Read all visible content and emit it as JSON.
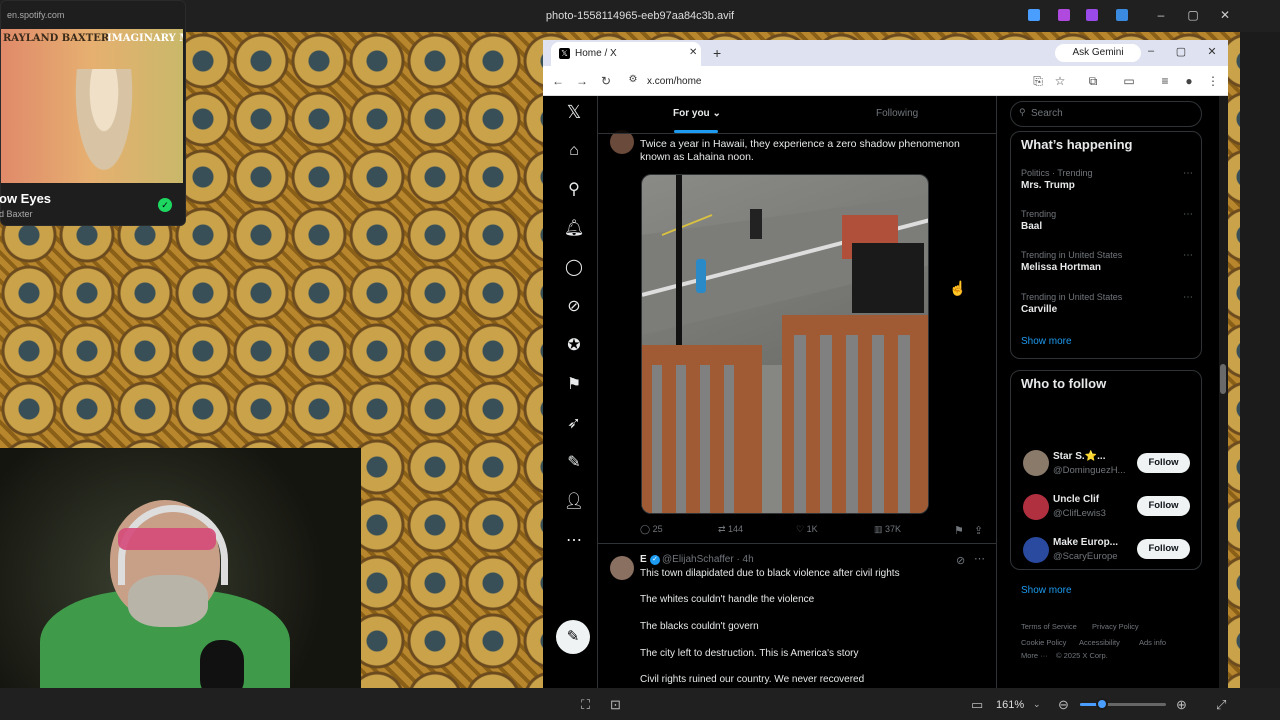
{
  "viewer": {
    "title": "photo-1558114965-eeb97aa84c3b.avif",
    "zoom": "161%",
    "zoom_fraction": 0.23
  },
  "spotify": {
    "url": "en.spotify.com",
    "art_text_artist": "RAYLAND BAXTER",
    "art_text_album": "IMAGINARY MAN",
    "track": "ow Eyes",
    "artist": "d Baxter"
  },
  "browser": {
    "tab_title": "Home / X",
    "ask_gemini": "Ask Gemini",
    "url": "x.com/home"
  },
  "x": {
    "tabs": {
      "for_you": "For you",
      "following": "Following"
    },
    "post1": {
      "text": "Twice a year in Hawaii, they experience a zero shadow phenomenon known as Lahaina noon.",
      "replies": "25",
      "reposts": "144",
      "likes": "1K",
      "views": "37K"
    },
    "post2": {
      "name": "E",
      "handle": "@ElijahSchaffer · 4h",
      "lines": [
        "This town dilapidated due to black violence after civil rights",
        "The whites couldn't handle the violence",
        "The blacks couldn't govern",
        "The city left to destruction. This is America's story",
        "Civil rights ruined our country. We never recovered"
      ]
    },
    "search_placeholder": "Search",
    "whats_happening": {
      "title": "What’s happening",
      "trends": [
        {
          "meta": "Politics · Trending",
          "name": "Mrs. Trump"
        },
        {
          "meta": "Trending",
          "name": "Baal"
        },
        {
          "meta": "Trending in United States",
          "name": "Melissa Hortman"
        },
        {
          "meta": "Trending in United States",
          "name": "Carville"
        }
      ],
      "show_more": "Show more"
    },
    "who_to_follow": {
      "title": "Who to follow",
      "accounts": [
        {
          "name": "Star S.⭐...",
          "handle": "@DominguezH...",
          "button": "Follow"
        },
        {
          "name": "Uncle Clif",
          "handle": "@ClifLewis3",
          "button": "Follow"
        },
        {
          "name": "Make Europ...",
          "handle": "@ScaryEurope",
          "button": "Follow"
        }
      ],
      "show_more": "Show more"
    },
    "footer": {
      "terms": "Terms of Service",
      "privacy": "Privacy Policy",
      "cookie": "Cookie Policy",
      "accessibility": "Accessibility",
      "ads": "Ads info",
      "more": "More ···",
      "copyright": "© 2025 X Corp."
    }
  },
  "colors": {
    "accent": "#1d9bf0",
    "spotify_green": "#1ed760"
  }
}
